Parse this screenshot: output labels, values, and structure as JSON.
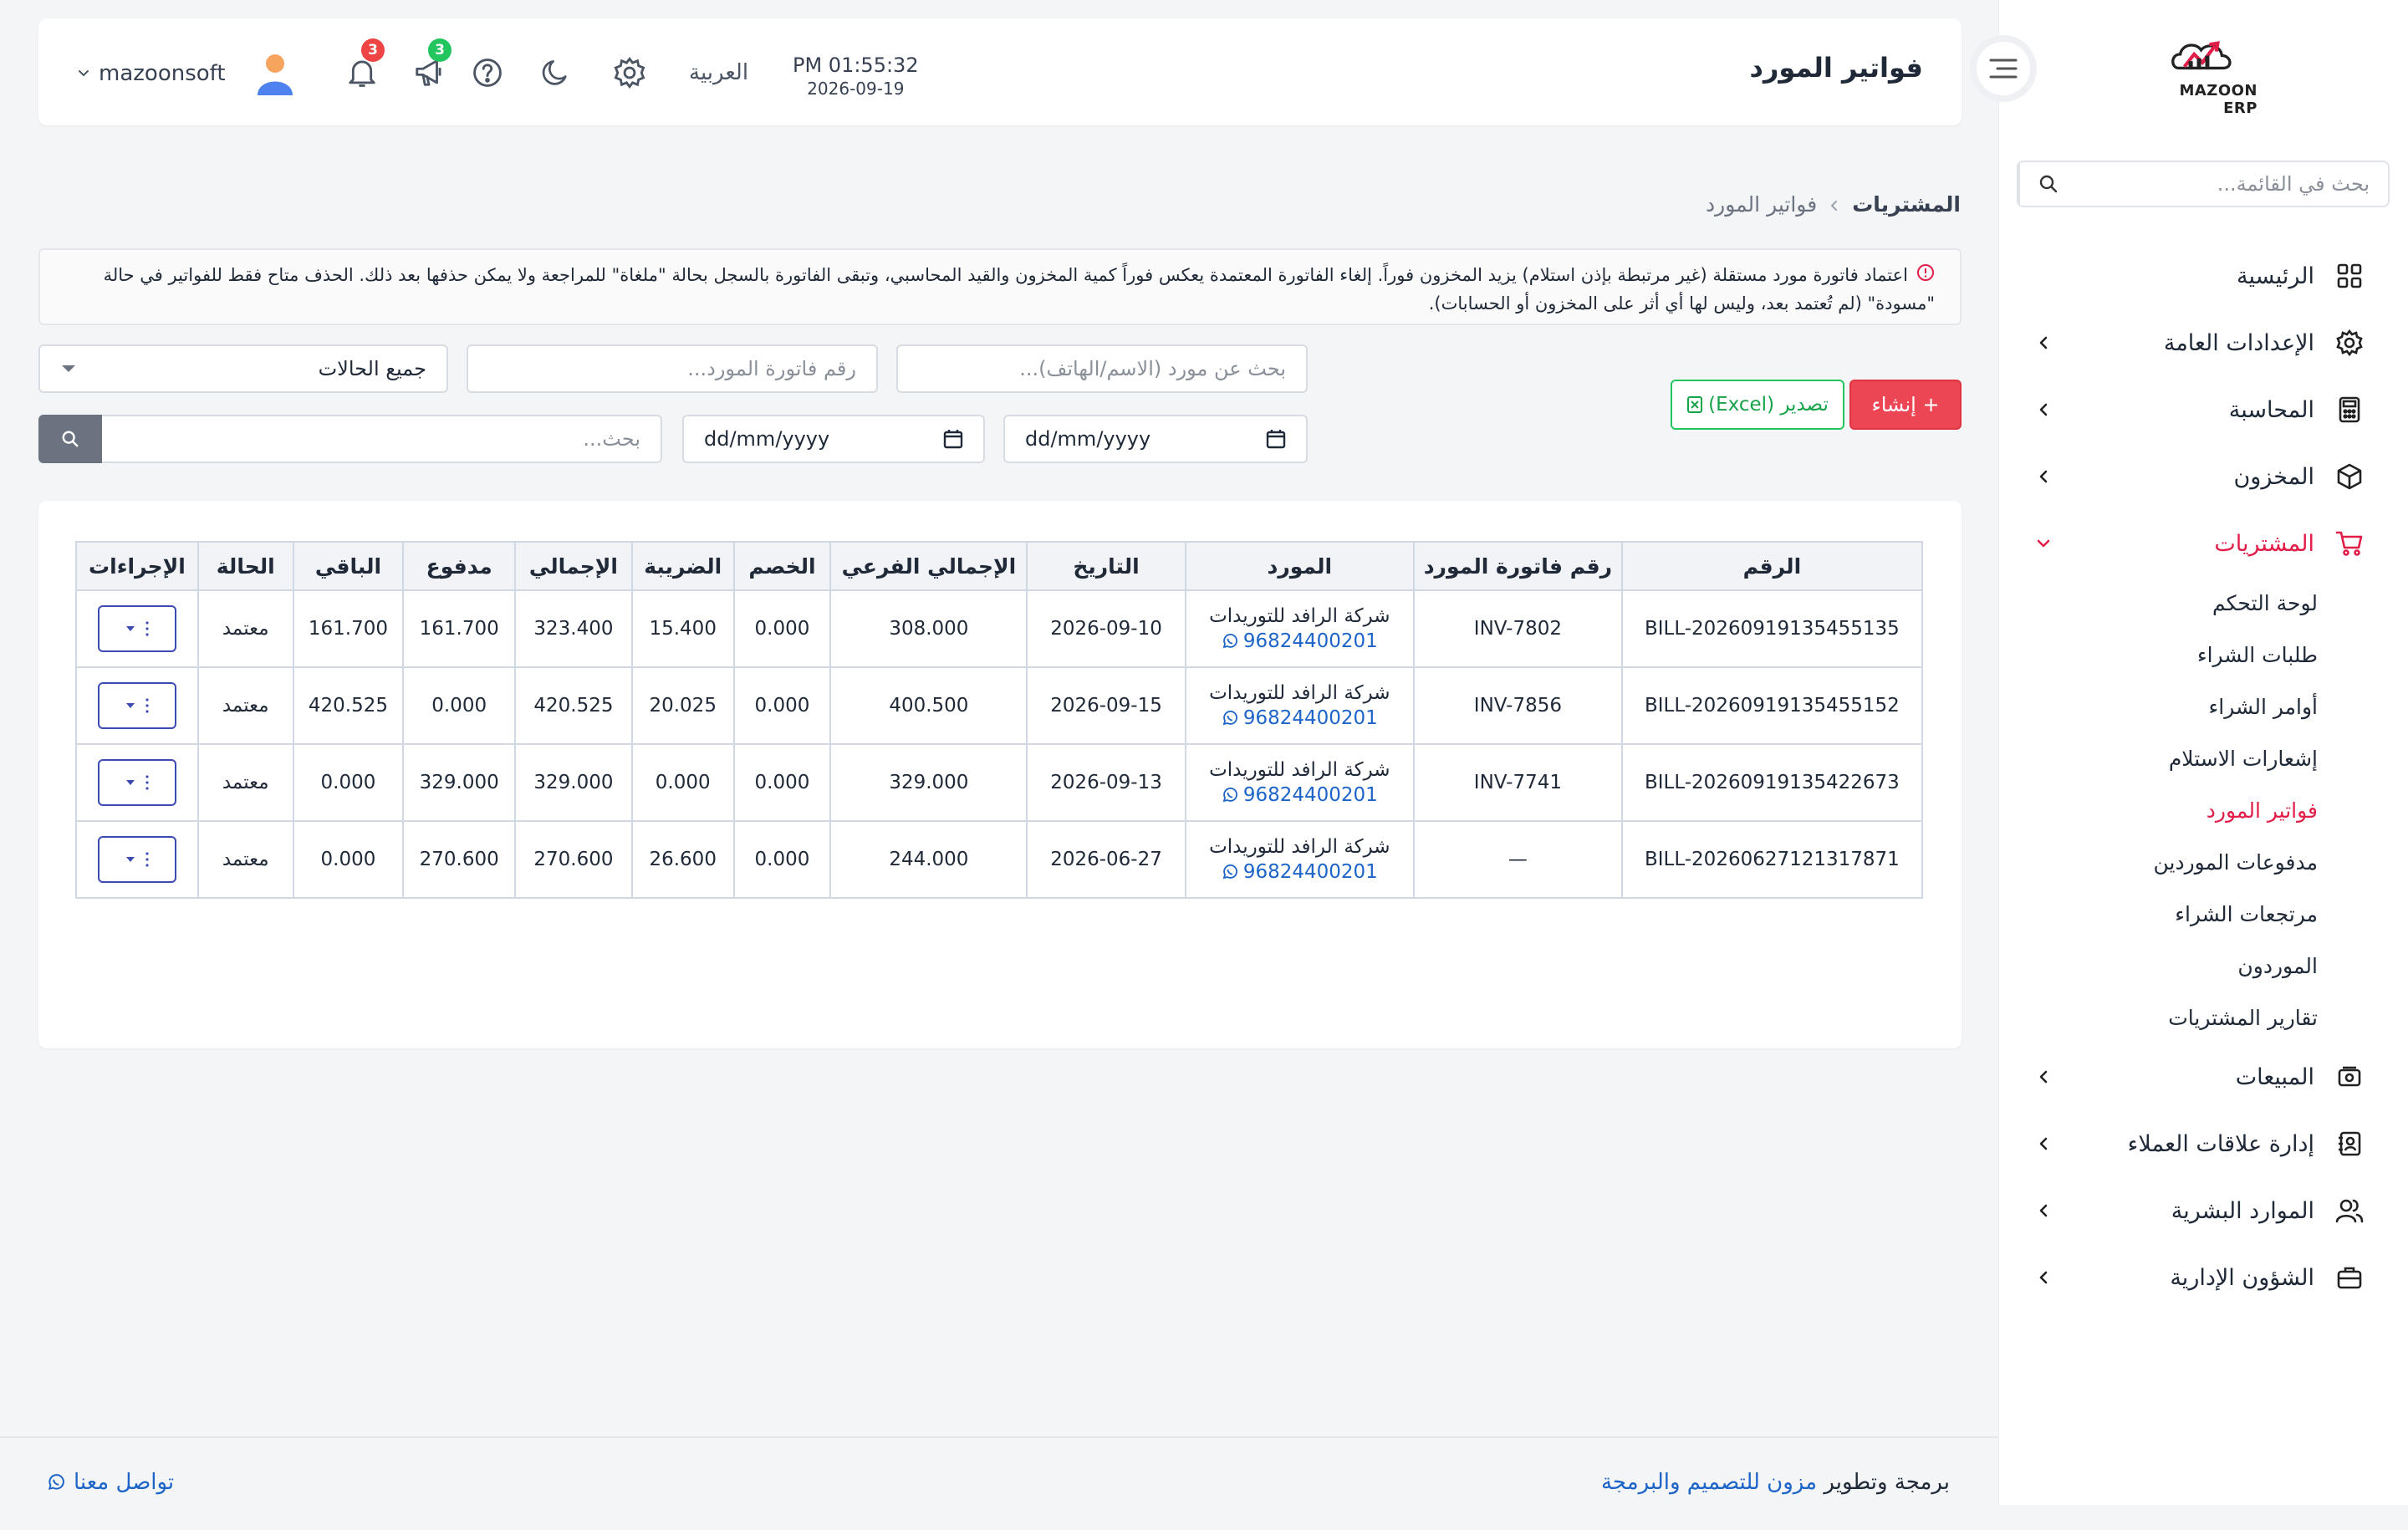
{
  "sidebar": {
    "logo_text": "MAZOON ERP",
    "search_placeholder": "بحث في القائمة...",
    "items": [
      {
        "label": "الرئيسية",
        "icon": "grid-icon"
      },
      {
        "label": "الإعدادات العامة",
        "icon": "gear-icon"
      },
      {
        "label": "المحاسبة",
        "icon": "calculator-icon"
      },
      {
        "label": "المخزون",
        "icon": "box-icon"
      },
      {
        "label": "المشتريات",
        "icon": "cart-icon"
      },
      {
        "label": "المبيعات",
        "icon": "cash-icon"
      },
      {
        "label": "إدارة علاقات العملاء",
        "icon": "contacts-icon"
      },
      {
        "label": "الموارد البشرية",
        "icon": "users-icon"
      },
      {
        "label": "الشؤون الإدارية",
        "icon": "briefcase-icon"
      }
    ],
    "purchases_sub": [
      "لوحة التحكم",
      "طلبات الشراء",
      "أوامر الشراء",
      "إشعارات الاستلام",
      "فواتير المورد",
      "مدفوعات الموردين",
      "مرتجعات الشراء",
      "الموردون",
      "تقارير المشتريات"
    ]
  },
  "header": {
    "title": "فواتير المورد",
    "time": "PM 01:55:32",
    "date": "2026-09-19",
    "language": "العربية",
    "notifications_count": "3",
    "announcements_count": "3",
    "username": "mazoonsoft"
  },
  "breadcrumb": {
    "parent": "المشتريات",
    "current": "فواتير المورد"
  },
  "info": {
    "text": "اعتماد فاتورة مورد مستقلة (غير مرتبطة بإذن استلام) يزيد المخزون فوراً. إلغاء الفاتورة المعتمدة يعكس فوراً كمية المخزون والقيد المحاسبي، وتبقى الفاتورة بالسجل بحالة \"ملغاة\" للمراجعة ولا يمكن حذفها بعد ذلك. الحذف متاح فقط للفواتير في حالة \"مسودة\" (لم تُعتمد بعد، وليس لها أي أثر على المخزون أو الحسابات)."
  },
  "filters": {
    "supplier_placeholder": "بحث عن مورد (الاسم/الهاتف)...",
    "invoice_placeholder": "رقم فاتورة المورد...",
    "status_value": "جميع الحالات",
    "date_from": "dd/mm/yyyy",
    "date_to": "dd/mm/yyyy",
    "search_placeholder": "بحث...",
    "create_label": "+ إنشاء",
    "export_label": "تصدير (Excel)"
  },
  "table": {
    "headers": [
      "الرقم",
      "رقم فاتورة المورد",
      "المورد",
      "التاريخ",
      "الإجمالي الفرعي",
      "الخصم",
      "الضريبة",
      "الإجمالي",
      "مدفوع",
      "الباقي",
      "الحالة",
      "الإجراءات"
    ],
    "rows": [
      {
        "no": "BILL-20260919135455135",
        "inv": "INV-7802",
        "supplier": "شركة الرافد للتوريدات",
        "phone": "96824400201",
        "date": "2026-09-10",
        "subtotal": "308.000",
        "discount": "0.000",
        "tax": "15.400",
        "total": "323.400",
        "paid": "161.700",
        "remaining": "161.700",
        "status": "معتمد"
      },
      {
        "no": "BILL-20260919135455152",
        "inv": "INV-7856",
        "supplier": "شركة الرافد للتوريدات",
        "phone": "96824400201",
        "date": "2026-09-15",
        "subtotal": "400.500",
        "discount": "0.000",
        "tax": "20.025",
        "total": "420.525",
        "paid": "0.000",
        "remaining": "420.525",
        "status": "معتمد"
      },
      {
        "no": "BILL-20260919135422673",
        "inv": "INV-7741",
        "supplier": "شركة الرافد للتوريدات",
        "phone": "96824400201",
        "date": "2026-09-13",
        "subtotal": "329.000",
        "discount": "0.000",
        "tax": "0.000",
        "total": "329.000",
        "paid": "329.000",
        "remaining": "0.000",
        "status": "معتمد"
      },
      {
        "no": "BILL-20260627121317871",
        "inv": "—",
        "supplier": "شركة الرافد للتوريدات",
        "phone": "96824400201",
        "date": "2026-06-27",
        "subtotal": "244.000",
        "discount": "0.000",
        "tax": "26.600",
        "total": "270.600",
        "paid": "270.600",
        "remaining": "0.000",
        "status": "معتمد"
      }
    ]
  },
  "footer": {
    "credit_prefix": "برمجة وتطوير",
    "credit_link": "مزون للتصميم والبرمجة",
    "contact": "تواصل معنا"
  },
  "colors": {
    "accent": "#e11d48",
    "create_button": "#ec4553",
    "export_green": "#22c55e",
    "link_blue": "#1d64c8",
    "badge_red": "#ef4444",
    "badge_green": "#22c55e"
  }
}
